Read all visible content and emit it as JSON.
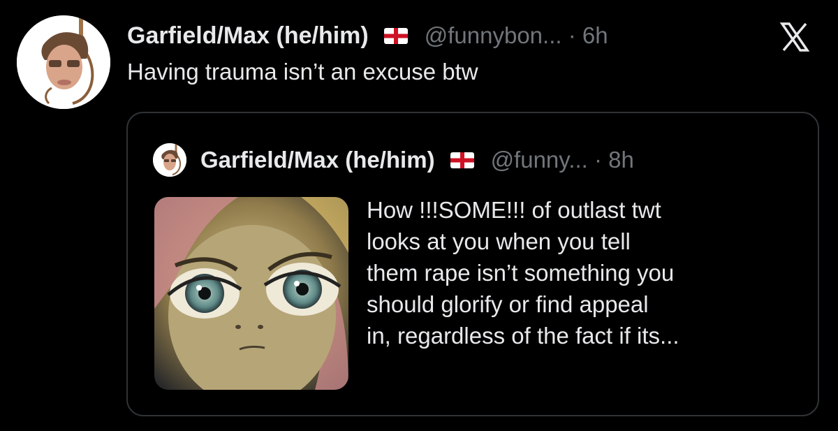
{
  "tweet": {
    "author_name": "Garfield/Max (he/him)",
    "flag_emoji": "england-flag-icon",
    "handle_time": "@funnybon... · 6h",
    "text": "Having trauma isn’t an excuse btw",
    "platform_logo": "x-logo-icon"
  },
  "quoted_tweet": {
    "author_name": "Garfield/Max (he/him)",
    "flag_emoji": "england-flag-icon",
    "handle_time": "@funny... · 8h",
    "text_lines": [
      "How !!!SOME!!! of outlast twt",
      "looks at you when you tell",
      "them rape isn’t something you",
      "should glorify or find appeal",
      "in, regardless of the fact if its..."
    ],
    "image": "angry-pony-face-image"
  },
  "colors": {
    "background": "#000000",
    "text_primary": "#e7e9ea",
    "text_secondary": "#71767b",
    "border": "#2f3336",
    "flag_red": "#ce1124"
  }
}
